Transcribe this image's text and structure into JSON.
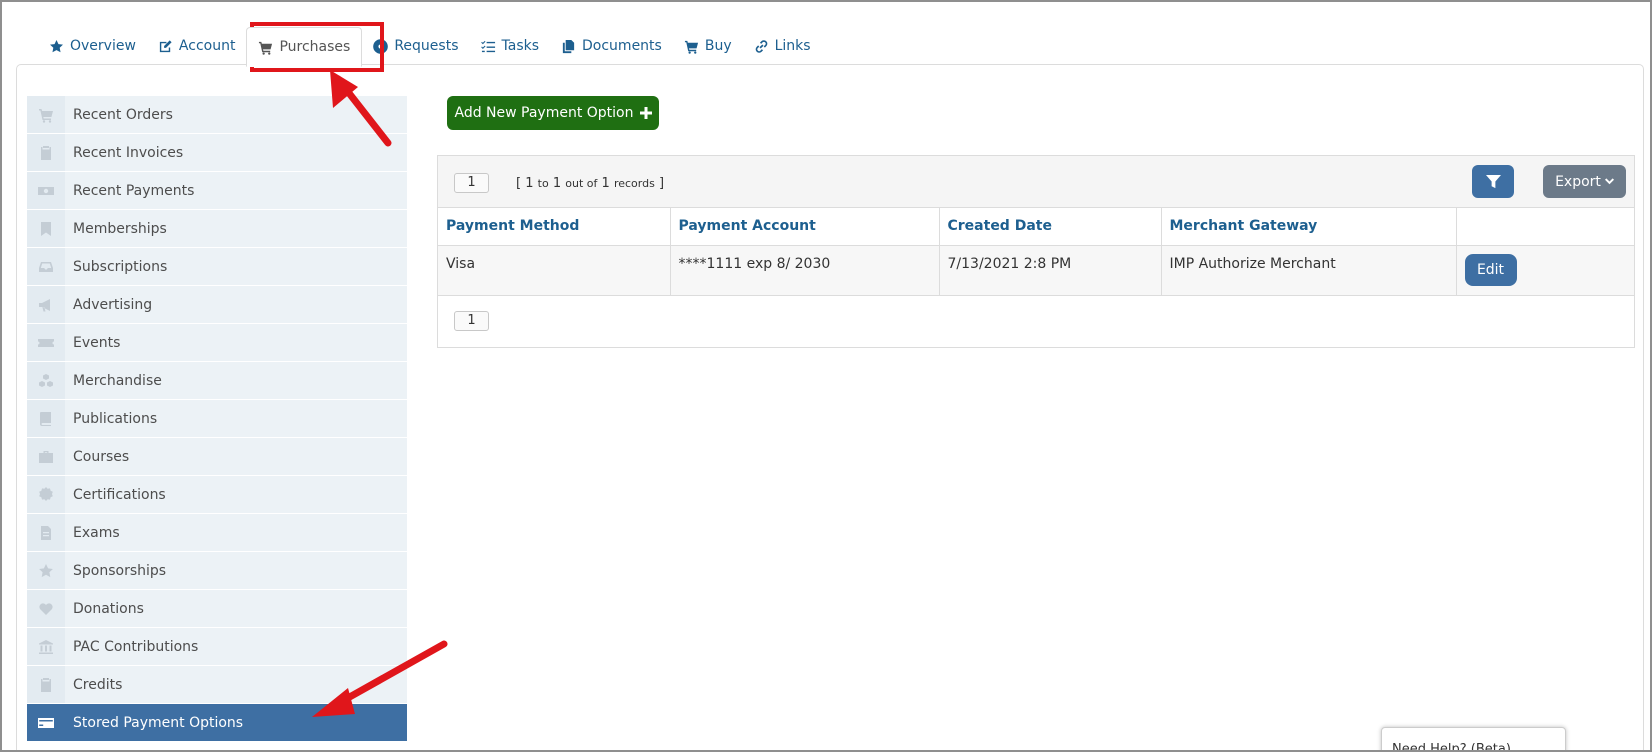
{
  "tabs": [
    {
      "label": "Overview",
      "icon": "star-icon"
    },
    {
      "label": "Account",
      "icon": "edit-icon"
    },
    {
      "label": "Purchases",
      "icon": "cart-icon",
      "active": true
    },
    {
      "label": "Requests",
      "icon": "lifering-icon"
    },
    {
      "label": "Tasks",
      "icon": "tasks-icon"
    },
    {
      "label": "Documents",
      "icon": "documents-icon"
    },
    {
      "label": "Buy",
      "icon": "cart-icon"
    },
    {
      "label": "Links",
      "icon": "link-icon"
    }
  ],
  "sidebar": {
    "items": [
      {
        "label": "Recent Orders",
        "icon": "cart-icon"
      },
      {
        "label": "Recent Invoices",
        "icon": "clipboard-icon"
      },
      {
        "label": "Recent Payments",
        "icon": "money-icon"
      },
      {
        "label": "Memberships",
        "icon": "bookmark-icon"
      },
      {
        "label": "Subscriptions",
        "icon": "inbox-icon"
      },
      {
        "label": "Advertising",
        "icon": "megaphone-icon"
      },
      {
        "label": "Events",
        "icon": "ticket-icon"
      },
      {
        "label": "Merchandise",
        "icon": "cubes-icon"
      },
      {
        "label": "Publications",
        "icon": "book-icon"
      },
      {
        "label": "Courses",
        "icon": "briefcase-icon"
      },
      {
        "label": "Certifications",
        "icon": "certificate-icon"
      },
      {
        "label": "Exams",
        "icon": "file-icon"
      },
      {
        "label": "Sponsorships",
        "icon": "star-icon"
      },
      {
        "label": "Donations",
        "icon": "heart-icon"
      },
      {
        "label": "PAC Contributions",
        "icon": "bank-icon"
      },
      {
        "label": "Credits",
        "icon": "clipboard-icon"
      },
      {
        "label": "Stored Payment Options",
        "icon": "credit-card-icon",
        "active": true
      }
    ]
  },
  "main": {
    "add_button_label": "Add New Payment Option",
    "pager_top": "1",
    "records": {
      "open": "[",
      "from": "1",
      "to_word": "to",
      "to": "1",
      "out_of_word": "out of",
      "total": "1",
      "records_word": "records",
      "close": "]"
    },
    "export_label": "Export",
    "pager_bottom": "1",
    "table": {
      "columns": [
        "Payment Method",
        "Payment Account",
        "Created Date",
        "Merchant Gateway",
        ""
      ],
      "rows": [
        {
          "method": "Visa",
          "account": "****1111 exp 8/ 2030",
          "created": "7/13/2021 2:8 PM",
          "gateway": "IMP Authorize Merchant",
          "action": "Edit"
        }
      ]
    }
  },
  "help_widget": {
    "label": "Need Help? (Beta)"
  },
  "colors": {
    "link": "#1d5f8f",
    "primary": "#3e6fa3",
    "success": "#1f6f12",
    "annotation": "#e0161b"
  }
}
